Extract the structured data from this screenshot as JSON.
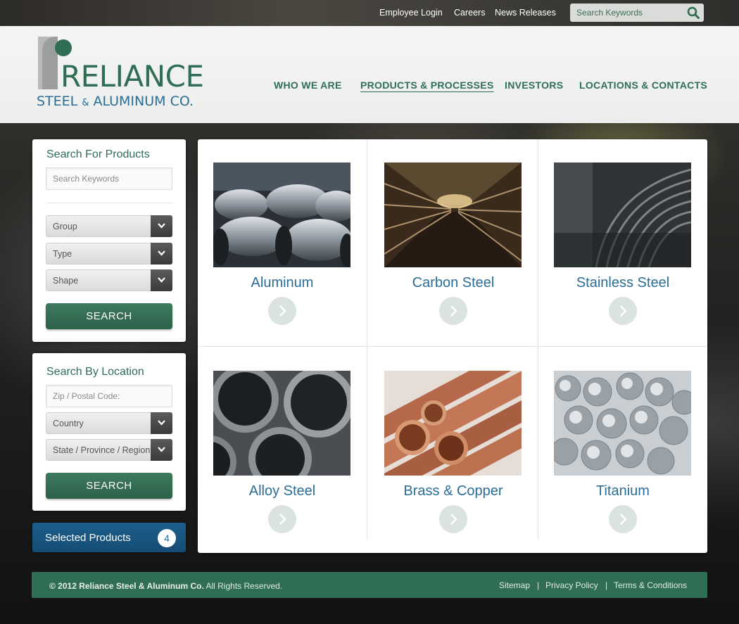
{
  "topbar": {
    "links": [
      "Employee Login",
      "Careers",
      "News Releases"
    ],
    "search_placeholder": "Search Keywords"
  },
  "logo": {
    "word": "RELIANCE",
    "sub_left": "STEEL",
    "sub_amp": "&",
    "sub_right": "ALUMINUM CO."
  },
  "nav": {
    "items": [
      "WHO WE ARE",
      "PRODUCTS & PROCESSES",
      "INVESTORS",
      "LOCATIONS & CONTACTS"
    ],
    "active_index": 1
  },
  "product_search": {
    "title": "Search For Products",
    "keyword_placeholder": "Search Keywords",
    "group": "Group",
    "type": "Type",
    "shape": "Shape",
    "button": "SEARCH"
  },
  "location_search": {
    "title": "Search By Location",
    "zip_placeholder": "Zip / Postal Code:",
    "country": "Country",
    "state": "State / Province / Region",
    "button": "SEARCH"
  },
  "selected_products": {
    "label": "Selected Products",
    "count": "4"
  },
  "products": [
    {
      "name": "Aluminum",
      "image": "aluminum-coils"
    },
    {
      "name": "Carbon Steel",
      "image": "carbon-steel-bars"
    },
    {
      "name": "Stainless Steel",
      "image": "stainless-coil"
    },
    {
      "name": "Alloy Steel",
      "image": "alloy-tubes"
    },
    {
      "name": "Brass & Copper",
      "image": "copper-pipes"
    },
    {
      "name": "Titanium",
      "image": "titanium-rods"
    }
  ],
  "footer": {
    "copyright_bold": "© 2012 Reliance Steel & Aluminum Co.",
    "copyright_rest": "All Rights Reserved.",
    "links": [
      "Sitemap",
      "Privacy Policy",
      "Terms & Conditions"
    ],
    "separator": "|"
  },
  "colors": {
    "brand_green": "#2f6e55",
    "brand_blue": "#2b6d95"
  }
}
